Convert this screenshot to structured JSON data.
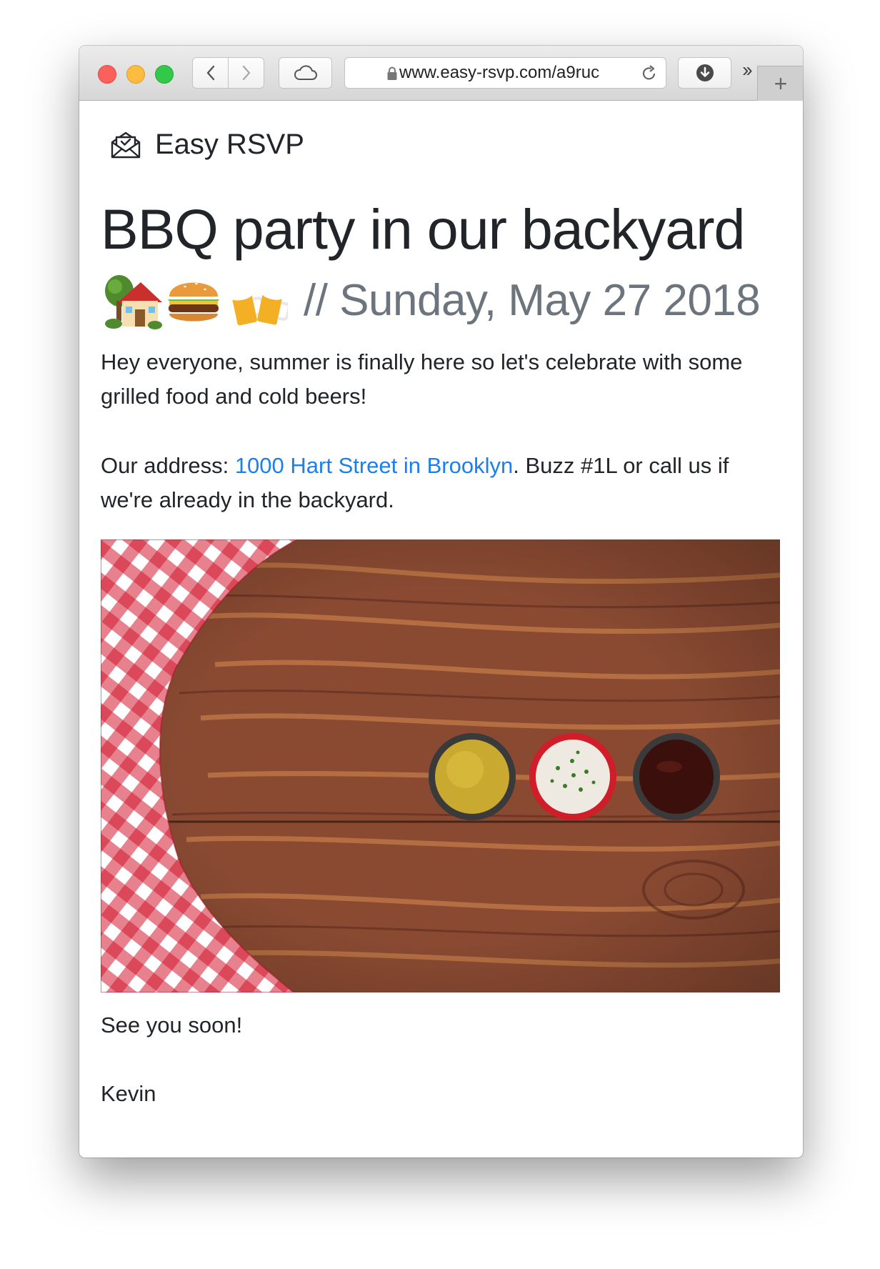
{
  "browser": {
    "url": "www.easy-rsvp.com/a9ruc",
    "more_label": "››",
    "new_tab_label": "+"
  },
  "brand": {
    "name": "Easy RSVP",
    "icon": "open-envelope-check-icon"
  },
  "event": {
    "title": "BBQ party in our backyard",
    "emojis": [
      "house-with-garden-icon",
      "hamburger-icon",
      "beer-mugs-icon"
    ],
    "date": "// Sunday, May 27 2018"
  },
  "body": {
    "intro": "Hey everyone, summer is finally here so let's celebrate with some grilled food and cold beers!",
    "address_prefix": "Our address: ",
    "address_link": "1000 Hart Street in Brooklyn",
    "address_suffix": ". Buzz #1L or call us if we're already in the backyard.",
    "closing": "See you soon!",
    "signature": "Kevin"
  },
  "colors": {
    "title": "#212529",
    "muted": "#6c757d",
    "link": "#1a7ff0"
  }
}
